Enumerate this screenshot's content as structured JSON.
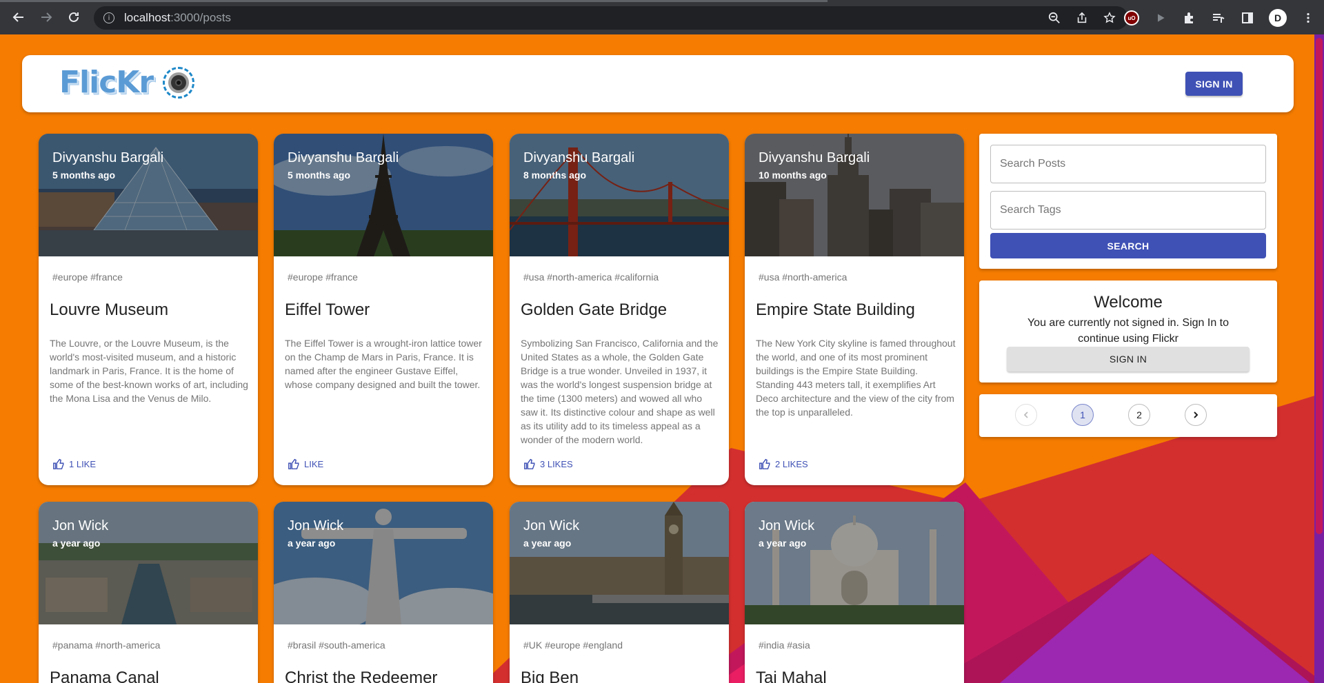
{
  "browser": {
    "url_host": "localhost",
    "url_path": ":3000/posts",
    "extension_badge": "uO",
    "profile_initial": "D"
  },
  "header": {
    "logo_text": "FlicKr",
    "signin_label": "SIGN IN"
  },
  "posts": [
    {
      "author": "Divyanshu Bargali",
      "time": "5 months ago",
      "tags": "#europe #france",
      "title": "Louvre Museum",
      "description": "The Louvre, or the Louvre Museum, is the world's most-visited museum, and a historic landmark in Paris, France. It is the home of some of the best-known works of art, including the Mona Lisa and the Venus de Milo.",
      "likes": "1 LIKE"
    },
    {
      "author": "Divyanshu Bargali",
      "time": "5 months ago",
      "tags": "#europe #france",
      "title": "Eiffel Tower",
      "description": "The Eiffel Tower is a wrought-iron lattice tower on the Champ de Mars in Paris, France. It is named after the engineer Gustave Eiffel, whose company designed and built the tower.",
      "likes": "LIKE"
    },
    {
      "author": "Divyanshu Bargali",
      "time": "8 months ago",
      "tags": "#usa #north-america #california",
      "title": "Golden Gate Bridge",
      "description": "Symbolizing San Francisco, California and the United States as a whole, the Golden Gate Bridge is a true wonder. Unveiled in 1937, it was the world's longest suspension bridge at the time (1300 meters) and wowed all who saw it. Its distinctive colour and shape as well as its utility add to its timeless appeal as a wonder of the modern world.",
      "likes": "3 LIKES"
    },
    {
      "author": "Divyanshu Bargali",
      "time": "10 months ago",
      "tags": "#usa #north-america",
      "title": "Empire State Building",
      "description": "The New York City skyline is famed throughout the world, and one of its most prominent buildings is the Empire State Building. Standing 443 meters tall, it exemplifies Art Deco architecture and the view of the city from the top is unparalleled.",
      "likes": "2 LIKES"
    },
    {
      "author": "Jon Wick",
      "time": "a year ago",
      "tags": "#panama #north-america",
      "title": "Panama Canal",
      "description": "",
      "likes": ""
    },
    {
      "author": "Jon Wick",
      "time": "a year ago",
      "tags": "#brasil #south-america",
      "title": "Christ the Redeemer",
      "description": "",
      "likes": ""
    },
    {
      "author": "Jon Wick",
      "time": "a year ago",
      "tags": "#UK #europe #england",
      "title": "Big Ben",
      "description": "",
      "likes": ""
    },
    {
      "author": "Jon Wick",
      "time": "a year ago",
      "tags": "#india #asia",
      "title": "Taj Mahal",
      "description": "",
      "likes": ""
    }
  ],
  "search": {
    "posts_placeholder": "Search Posts",
    "tags_placeholder": "Search Tags",
    "button_label": "SEARCH"
  },
  "welcome": {
    "title": "Welcome",
    "text": "You are currently not signed in. Sign In to continue using Flickr",
    "signin_label": "SIGN IN"
  },
  "pagination": {
    "pages": [
      "1",
      "2"
    ],
    "current": "1"
  },
  "colors": {
    "background": "#f57c00",
    "primary": "#3f51b5",
    "deco_red": "#d32f2f",
    "deco_magenta": "#c2185b",
    "deco_purple": "#9c27b0"
  }
}
